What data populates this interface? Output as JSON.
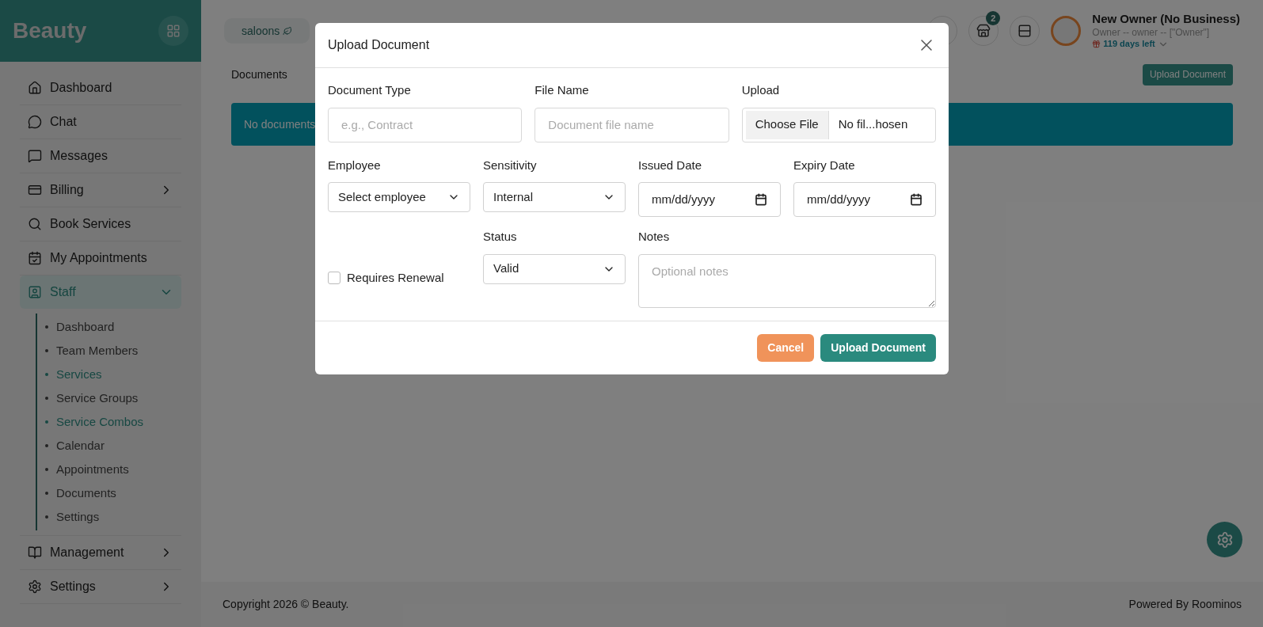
{
  "brand": "Beauty",
  "nav": [
    {
      "label": "Dashboard",
      "selected": false
    },
    {
      "label": "Chat",
      "selected": false
    },
    {
      "label": "Messages",
      "selected": false
    },
    {
      "label": "Billing",
      "selected": false,
      "expanded": false
    },
    {
      "label": "Book Services",
      "selected": false
    },
    {
      "label": "My Appointments",
      "selected": false
    },
    {
      "label": "Staff",
      "selected": true,
      "expanded": true,
      "children": [
        {
          "label": "Dashboard",
          "selected": false
        },
        {
          "label": "Team Members",
          "selected": false
        },
        {
          "label": "Services",
          "selected": true
        },
        {
          "label": "Service Groups",
          "selected": false
        },
        {
          "label": "Service Combos",
          "selected": true
        },
        {
          "label": "Calendar",
          "selected": false
        },
        {
          "label": "Appointments",
          "selected": false
        },
        {
          "label": "Documents",
          "selected": false
        },
        {
          "label": "Settings",
          "selected": false
        }
      ]
    },
    {
      "label": "Management",
      "selected": false,
      "expanded": false
    },
    {
      "label": "Settings",
      "selected": false,
      "expanded": false
    }
  ],
  "topbar": {
    "chip": "saloons",
    "badge": "2",
    "user": {
      "name": "New Owner (No Business)",
      "role": "Owner -- owner -- [\"Owner\"]",
      "trial": "119 days left"
    }
  },
  "page": {
    "title": "Documents",
    "upload_button": "Upload Document",
    "empty": "No documents"
  },
  "footer": {
    "copyright": "Copyright 2026 © Beauty.",
    "powered": "Powered By Roominos"
  },
  "dialog": {
    "title": "Upload Document",
    "fields": [
      {
        "kind": "text",
        "label": "Document Type",
        "placeholder": "e.g., Contract"
      },
      {
        "kind": "text",
        "label": "File Name",
        "placeholder": "Document file name"
      },
      {
        "kind": "file",
        "label": "Upload",
        "button": "Choose File",
        "value": "No fil...hosen"
      },
      {
        "kind": "select",
        "label": "Employee",
        "value": "Select employee"
      },
      {
        "kind": "select",
        "label": "Sensitivity",
        "value": "Internal"
      },
      {
        "kind": "date",
        "label": "Issued Date",
        "value": "mm/dd/yyyy"
      },
      {
        "kind": "date",
        "label": "Expiry Date",
        "value": "mm/dd/yyyy"
      },
      {
        "kind": "checkbox",
        "label": "Requires Renewal",
        "checked": false
      },
      {
        "kind": "select",
        "label": "Status",
        "value": "Valid"
      },
      {
        "kind": "textarea",
        "label": "Notes",
        "placeholder": "Optional notes"
      }
    ],
    "buttons": [
      {
        "kind": "cancel",
        "label": "Cancel"
      },
      {
        "kind": "primary",
        "label": "Upload Document"
      }
    ]
  }
}
